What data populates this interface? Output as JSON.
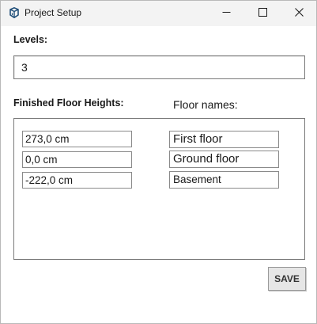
{
  "window": {
    "title": "Project Setup"
  },
  "levels": {
    "label": "Levels:",
    "value": "3"
  },
  "floors": {
    "heights_label": "Finished Floor Heights:",
    "names_label": "Floor names:",
    "rows": [
      {
        "height": "273,0 cm",
        "name": "First floor"
      },
      {
        "height": "0,0 cm",
        "name": "Ground floor"
      },
      {
        "height": "-222,0 cm",
        "name": "Basement"
      }
    ]
  },
  "actions": {
    "save_label": "SAVE"
  },
  "colors": {
    "titlebar": "#f3f3f3",
    "app_icon": "#1f4e79"
  },
  "icons": {
    "app": "sketchup-logo-icon",
    "minimize": "minimize-icon",
    "maximize": "maximize-icon",
    "close": "close-icon"
  }
}
